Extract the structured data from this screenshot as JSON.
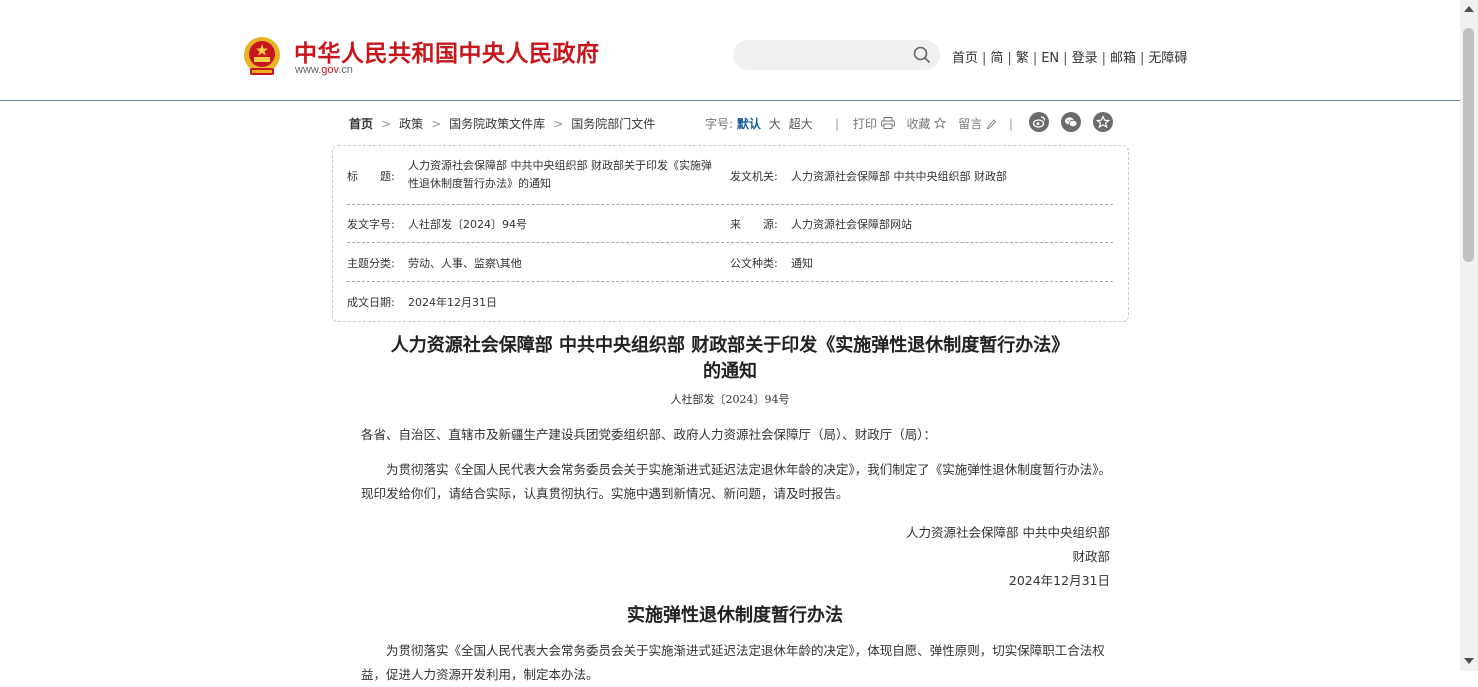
{
  "header": {
    "site_title": "中华人民共和国中央人民政府",
    "site_url_prefix": "www.",
    "site_url_domain": "gov",
    "site_url_suffix": ".cn",
    "search_placeholder": "",
    "nav": [
      "首页",
      "简",
      "繁",
      "EN",
      "登录",
      "邮箱",
      "无障碍"
    ],
    "nav_separator": "|"
  },
  "toolbar": {
    "breadcrumb": [
      "首页",
      "政策",
      "国务院政策文件库",
      "国务院部门文件"
    ],
    "breadcrumb_arrow": ">",
    "fontsize_label": "字号:",
    "fontsize_options": [
      "默认",
      "大",
      "超大"
    ],
    "print_label": "打印",
    "favorite_label": "收藏",
    "comment_label": "留言",
    "separator": "|"
  },
  "meta": {
    "title_label": "标　　题:",
    "title_value_line1": "人力资源社会保障部 中共中央组织部 财政部关于印发《实施弹",
    "title_value_line2": "性退休制度暂行办法》的通知",
    "issuer_label": "发文机关:",
    "issuer_value": "人力资源社会保障部 中共中央组织部 财政部",
    "doc_no_label": "发文字号:",
    "doc_no_value": "人社部发〔2024〕94号",
    "source_label": "来　　源:",
    "source_value": "人力资源社会保障部网站",
    "topic_label": "主题分类:",
    "topic_value": "劳动、人事、监察\\其他",
    "type_label": "公文种类:",
    "type_value": "通知",
    "date_label": "成文日期:",
    "date_value": "2024年12月31日"
  },
  "document": {
    "title_line1": "人力资源社会保障部 中共中央组织部 财政部关于印发《实施弹性退休制度暂行办法》",
    "title_line2": "的通知",
    "number": "人社部发〔2024〕94号",
    "salutation": "各省、自治区、直辖市及新疆生产建设兵团党委组织部、政府人力资源社会保障厅（局）、财政厅（局）：",
    "para1": "为贯彻落实《全国人民代表大会常务委员会关于实施渐进式延迟法定退休年龄的决定》，我们制定了《实施弹性退休制度暂行办法》。现印发给你们，请结合实际，认真贯彻执行。实施中遇到新情况、新问题，请及时报告。",
    "signer1": "人力资源社会保障部 中共中央组织部",
    "signer2": "财政部",
    "sign_date": "2024年12月31日",
    "sub_title": "实施弹性退休制度暂行办法",
    "para2": "为贯彻落实《全国人民代表大会常务委员会关于实施渐进式延迟法定退休年龄的决定》，体现自愿、弹性原则，切实保障职工合法权益，促进人力资源开发利用，制定本办法。"
  },
  "colors": {
    "brand_red": "#c8161d",
    "accent_blue": "#1a5b9c",
    "emblem_gold": "#e8b426"
  },
  "icons": {
    "emblem": "national-emblem-icon",
    "search": "search-icon",
    "print": "printer-icon",
    "favorite": "star-outline-icon",
    "comment": "pencil-icon",
    "social": [
      "weibo-icon",
      "wechat-icon",
      "favorite-circle-icon"
    ]
  }
}
